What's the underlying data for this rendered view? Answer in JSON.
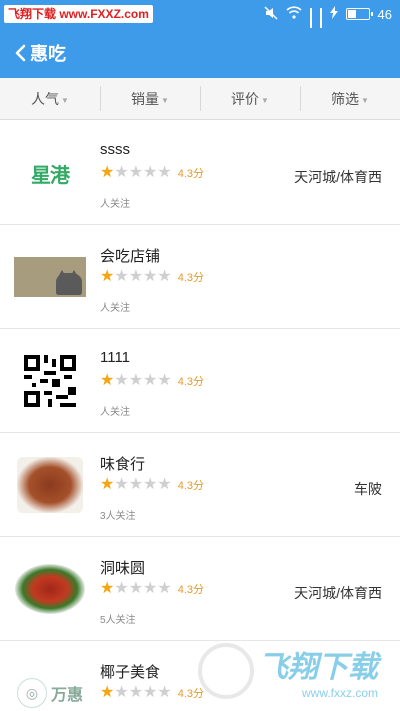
{
  "status_bar": {
    "watermark_label": "飞翔下载 www.FXXZ.com",
    "battery_text": "46",
    "battery_level": 0.46
  },
  "nav": {
    "title": "惠吃"
  },
  "filters": [
    {
      "label": "人气"
    },
    {
      "label": "销量"
    },
    {
      "label": "评价"
    },
    {
      "label": "筛选"
    }
  ],
  "shops": [
    {
      "name": "ssss",
      "rating": 1,
      "score_text": "4.3分",
      "follow_text": "人关注",
      "area": "天河城/体育西",
      "thumb": "logo-icon"
    },
    {
      "name": "会吃店铺",
      "rating": 1,
      "score_text": "4.3分",
      "follow_text": "人关注",
      "area": "",
      "thumb": "cat-photo-icon"
    },
    {
      "name": "1111",
      "rating": 1,
      "score_text": "4.3分",
      "follow_text": "人关注",
      "area": "",
      "thumb": "qr-code-icon"
    },
    {
      "name": "味食行",
      "rating": 1,
      "score_text": "4.3分",
      "follow_text": "3人关注",
      "area": "车陂",
      "thumb": "ribs-photo-icon"
    },
    {
      "name": "洞味圆",
      "rating": 1,
      "score_text": "4.3分",
      "follow_text": "5人关注",
      "area": "天河城/体育西",
      "thumb": "dish-photo-icon"
    },
    {
      "name": "椰子美食",
      "rating": 1,
      "score_text": "4.3分",
      "follow_text": "",
      "area": "",
      "thumb": "brand-logo-icon"
    }
  ],
  "thumb_texts": {
    "logo": "星港",
    "brand": "万惠"
  },
  "watermark": {
    "title": "飞翔下载",
    "url": "www.fxxz.com"
  },
  "colors": {
    "accent": "#3d9be9",
    "star_on": "#f2a60c",
    "star_off": "#cfcfcf",
    "score": "#e59a2a"
  }
}
